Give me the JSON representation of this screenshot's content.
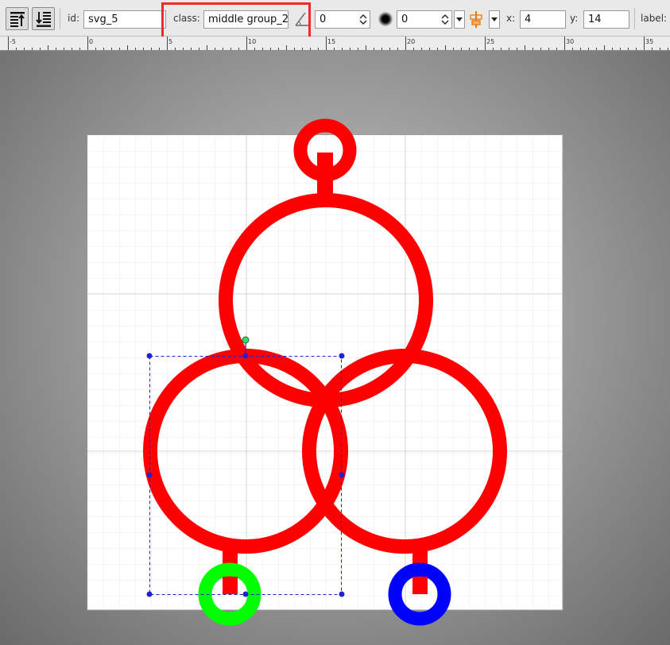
{
  "toolbar": {
    "id_label": "id:",
    "id_value": "svg_5",
    "class_label": "class:",
    "class_value": "middle group_2",
    "angle_value": "0",
    "blur_value": "0",
    "x_label": "x:",
    "x_value": "4",
    "y_label": "y:",
    "y_value": "14",
    "label_label": "label:"
  },
  "icons": {
    "move_top": "align-top-icon",
    "move_bottom": "align-bottom-icon",
    "angle": "angle-icon",
    "blur": "blur-icon",
    "align": "align-icon"
  },
  "ruler": {
    "labels": [
      "-5",
      "0",
      "5",
      "10",
      "15",
      "20",
      "25",
      "30",
      "35"
    ]
  },
  "colors": {
    "highlight": "#ee2a2a",
    "shape_red": "#ff0000",
    "shape_green": "#00ff00",
    "shape_blue": "#0000ff",
    "selection": "#2222cc"
  }
}
